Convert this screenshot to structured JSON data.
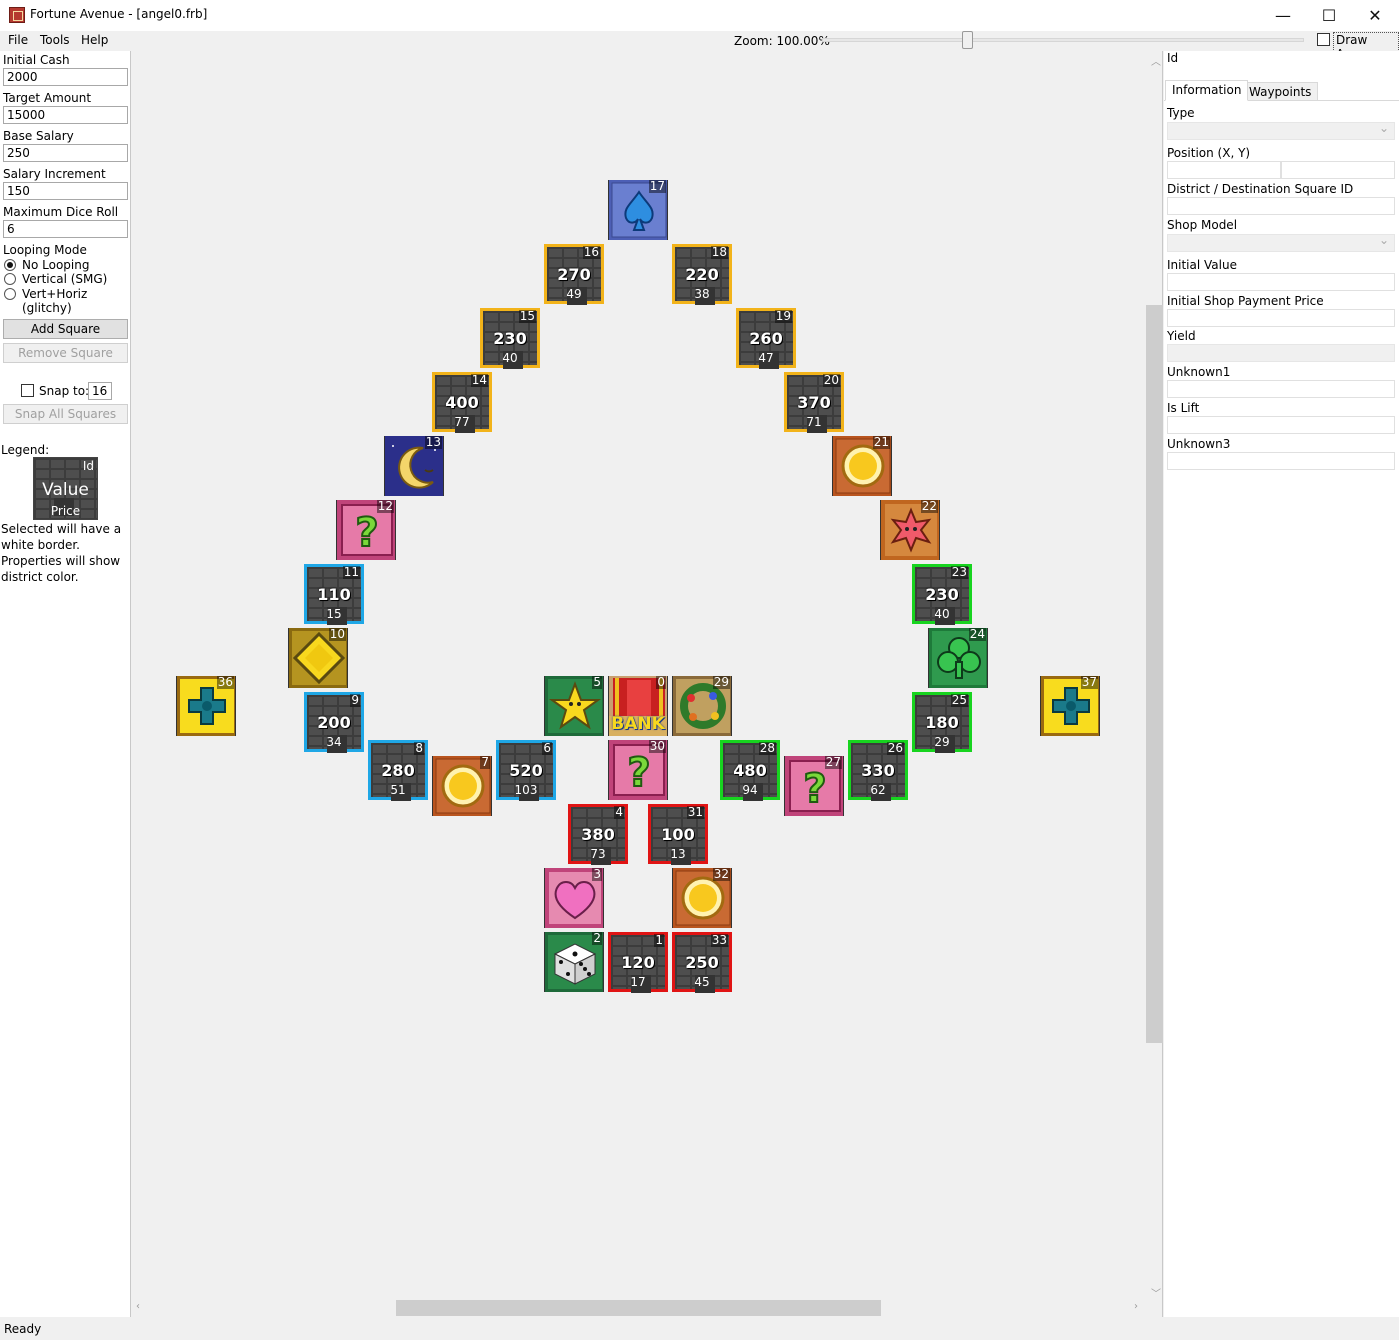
{
  "window": {
    "title": "Fortune Avenue - [angel0.frb]",
    "minimize": "—",
    "maximize": "☐",
    "close": "✕"
  },
  "menu": {
    "file": "File",
    "tools": "Tools",
    "help": "Help",
    "zoom_label": "Zoom: 100.00%",
    "zoom_level": 0.3,
    "draw_axes": "Draw Axes",
    "draw_axes_checked": false
  },
  "left": {
    "initial_cash_label": "Initial Cash",
    "initial_cash": "2000",
    "target_label": "Target Amount",
    "target": "15000",
    "base_salary_label": "Base Salary",
    "base_salary": "250",
    "salary_inc_label": "Salary Increment",
    "salary_inc": "150",
    "max_dice_label": "Maximum Dice Roll",
    "max_dice": "6",
    "looping_label": "Looping Mode",
    "looping_options": [
      "No Looping",
      "Vertical (SMG)",
      "Vert+Horiz (glitchy)"
    ],
    "looping_selected": 0,
    "add_square": "Add Square",
    "remove_square": "Remove Square",
    "snap_label": "Snap to:",
    "snap_value": "16",
    "snap_all": "Snap All Squares",
    "legend_label": "Legend:",
    "legend_id": "Id",
    "legend_value": "Value",
    "legend_price": "Price",
    "legend_note": "Selected will have a white border. Properties will show district color."
  },
  "right": {
    "id_label": "Id",
    "tab_information": "Information",
    "tab_waypoints": "Waypoints",
    "type_label": "Type",
    "position_label": "Position (X, Y)",
    "district_label": "District / Destination Square ID",
    "shop_model_label": "Shop Model",
    "initial_value_label": "Initial Value",
    "initial_shop_price_label": "Initial Shop Payment Price",
    "yield_label": "Yield",
    "unknown1_label": "Unknown1",
    "is_lift_label": "Is Lift",
    "unknown3_label": "Unknown3"
  },
  "status": {
    "text": "Ready"
  },
  "colors": {
    "district_yellow": "#f2b31a",
    "district_blue": "#1fa7e6",
    "district_green": "#17d41f",
    "district_red": "#e01414"
  },
  "board": {
    "squares": [
      {
        "id": "17",
        "kind": "spade-icon"
      },
      {
        "id": "16",
        "kind": "shop",
        "value": "270",
        "price": "49",
        "district": "yellow"
      },
      {
        "id": "18",
        "kind": "shop",
        "value": "220",
        "price": "38",
        "district": "yellow"
      },
      {
        "id": "15",
        "kind": "shop",
        "value": "230",
        "price": "40",
        "district": "yellow"
      },
      {
        "id": "19",
        "kind": "shop",
        "value": "260",
        "price": "47",
        "district": "yellow"
      },
      {
        "id": "14",
        "kind": "shop",
        "value": "400",
        "price": "77",
        "district": "yellow"
      },
      {
        "id": "20",
        "kind": "shop",
        "value": "370",
        "price": "71",
        "district": "yellow"
      },
      {
        "id": "13",
        "kind": "moon-icon"
      },
      {
        "id": "21",
        "kind": "coin-icon"
      },
      {
        "id": "12",
        "kind": "question-icon"
      },
      {
        "id": "22",
        "kind": "star-burst-icon"
      },
      {
        "id": "11",
        "kind": "shop",
        "value": "110",
        "price": "15",
        "district": "blue"
      },
      {
        "id": "23",
        "kind": "shop",
        "value": "230",
        "price": "40",
        "district": "green"
      },
      {
        "id": "10",
        "kind": "diamond-icon"
      },
      {
        "id": "24",
        "kind": "club-icon"
      },
      {
        "id": "36",
        "kind": "cross-icon"
      },
      {
        "id": "9",
        "kind": "shop",
        "value": "200",
        "price": "34",
        "district": "blue"
      },
      {
        "id": "5",
        "kind": "star-icon"
      },
      {
        "id": "0",
        "kind": "bank-icon",
        "label": "BANK"
      },
      {
        "id": "29",
        "kind": "wreath-icon"
      },
      {
        "id": "25",
        "kind": "shop",
        "value": "180",
        "price": "29",
        "district": "green"
      },
      {
        "id": "37",
        "kind": "cross-icon"
      },
      {
        "id": "8",
        "kind": "shop",
        "value": "280",
        "price": "51",
        "district": "blue"
      },
      {
        "id": "7",
        "kind": "coin-icon"
      },
      {
        "id": "6",
        "kind": "shop",
        "value": "520",
        "price": "103",
        "district": "blue"
      },
      {
        "id": "30",
        "kind": "question-icon"
      },
      {
        "id": "28",
        "kind": "shop",
        "value": "480",
        "price": "94",
        "district": "green"
      },
      {
        "id": "27",
        "kind": "question-icon"
      },
      {
        "id": "26",
        "kind": "shop",
        "value": "330",
        "price": "62",
        "district": "green"
      },
      {
        "id": "4",
        "kind": "shop",
        "value": "380",
        "price": "73",
        "district": "red"
      },
      {
        "id": "31",
        "kind": "shop",
        "value": "100",
        "price": "13",
        "district": "red"
      },
      {
        "id": "3",
        "kind": "heart-icon"
      },
      {
        "id": "32",
        "kind": "coin-icon"
      },
      {
        "id": "2",
        "kind": "dice-icon"
      },
      {
        "id": "1",
        "kind": "shop",
        "value": "120",
        "price": "17",
        "district": "red"
      },
      {
        "id": "33",
        "kind": "shop",
        "value": "250",
        "price": "45",
        "district": "red"
      }
    ]
  }
}
